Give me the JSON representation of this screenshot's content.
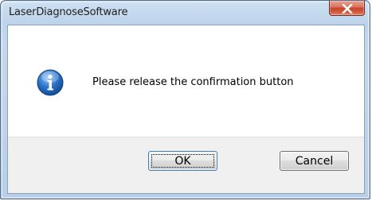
{
  "window": {
    "title": "LaserDiagnoseSoftware",
    "close_label": "X"
  },
  "dialog": {
    "icon": "info-icon",
    "message": "Please release the confirmation button"
  },
  "buttons": {
    "ok_label": "OK",
    "cancel_label": "Cancel"
  },
  "colors": {
    "close_button": "#c6452d",
    "info_icon": "#1d5fb5",
    "button_area": "#f0f0f0"
  }
}
